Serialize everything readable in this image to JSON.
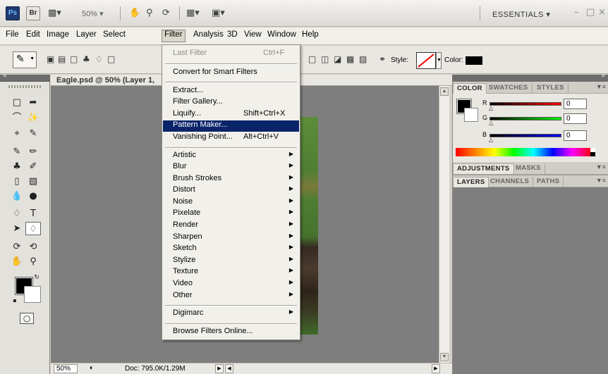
{
  "appbar": {
    "ps_logo": "Ps",
    "br_logo": "Br",
    "zoom": "50%",
    "workspace": "ESSENTIALS",
    "icons": [
      "frame-icon",
      "hand-icon",
      "zoom-icon",
      "rotate-view-icon",
      "arrange-documents-icon",
      "screen-mode-icon"
    ]
  },
  "menubar": {
    "items": [
      "File",
      "Edit",
      "Image",
      "Layer",
      "Select",
      "Filter",
      "Analysis",
      "3D",
      "View",
      "Window",
      "Help"
    ],
    "active": "Filter"
  },
  "options": {
    "style_label": "Style:",
    "color_label": "Color:"
  },
  "document": {
    "tab_title": "Eagle.psd @ 50% (Layer 1,",
    "status_zoom": "50%",
    "status_doc": "Doc: 795.0K/1.29M"
  },
  "filter_menu": {
    "last_filter": {
      "label": "Last Filter",
      "shortcut": "Ctrl+F"
    },
    "convert": "Convert for Smart Filters",
    "group1": [
      {
        "label": "Extract...",
        "shortcut": ""
      },
      {
        "label": "Filter Gallery...",
        "shortcut": ""
      },
      {
        "label": "Liquify...",
        "shortcut": "Shift+Ctrl+X"
      },
      {
        "label": "Pattern Maker...",
        "shortcut": ""
      },
      {
        "label": "Vanishing Point...",
        "shortcut": "Alt+Ctrl+V"
      }
    ],
    "group2": [
      "Artistic",
      "Blur",
      "Brush Strokes",
      "Distort",
      "Noise",
      "Pixelate",
      "Render",
      "Sharpen",
      "Sketch",
      "Stylize",
      "Texture",
      "Video",
      "Other"
    ],
    "digimarc": "Digimarc",
    "browse": "Browse Filters Online...",
    "highlighted": "Pattern Maker..."
  },
  "color_panel": {
    "tabs": [
      "COLOR",
      "SWATCHES",
      "STYLES"
    ],
    "r_label": "R",
    "g_label": "G",
    "b_label": "B",
    "r": "0",
    "g": "0",
    "b": "0"
  },
  "adjust_panel": {
    "tabs": [
      "ADJUSTMENTS",
      "MASKS"
    ]
  },
  "layers_panel": {
    "tabs": [
      "LAYERS",
      "CHANNELS",
      "PATHS"
    ]
  },
  "colors": {
    "highlight": "#0a246a",
    "workspace_gray": "#7e7e7e"
  }
}
